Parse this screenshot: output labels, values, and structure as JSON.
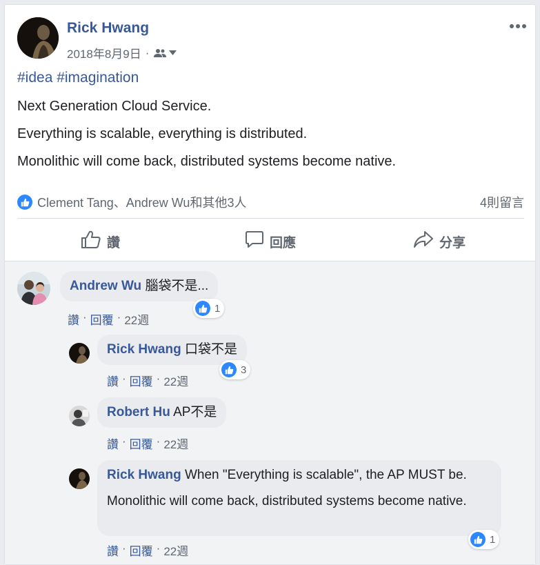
{
  "post": {
    "author": "Rick Hwang",
    "date": "2018年8月9日",
    "separator": "·",
    "hashtags": "#idea #imagination",
    "lines": [
      "Next Generation Cloud Service.",
      "Everything is scalable, everything is distributed.",
      "Monolithic will come back, distributed systems become native."
    ],
    "likers": "Clement Tang、Andrew Wu和其他3人",
    "comment_count": "4則留言",
    "actions": {
      "like": "讚",
      "comment": "回應",
      "share": "分享"
    }
  },
  "comments": [
    {
      "author": "Andrew Wu",
      "text": "腦袋不是...",
      "text2": "",
      "like": "讚",
      "reply": "回覆",
      "time": "22週",
      "reactions": "1",
      "dot": "·"
    },
    {
      "author": "Rick Hwang",
      "text": "口袋不是",
      "text2": "",
      "like": "讚",
      "reply": "回覆",
      "time": "22週",
      "reactions": "3",
      "dot": "·"
    },
    {
      "author": "Robert Hu",
      "text": "AP不是",
      "text2": "",
      "like": "讚",
      "reply": "回覆",
      "time": "22週",
      "reactions": "",
      "dot": "·"
    },
    {
      "author": "Rick Hwang",
      "text": "When \"Everything is scalable\", the AP MUST be.",
      "text2": "Monolithic will come back, distributed systems become native.",
      "like": "讚",
      "reply": "回覆",
      "time": "22週",
      "reactions": "1",
      "dot": "·"
    }
  ],
  "colors": {
    "link": "#385898",
    "muted": "#606770",
    "like_blue": "#2d88ff",
    "bubble": "#e9ebee"
  },
  "icons": [
    "friends-audience-icon",
    "more-icon",
    "like-icon",
    "comment-icon",
    "share-icon"
  ]
}
